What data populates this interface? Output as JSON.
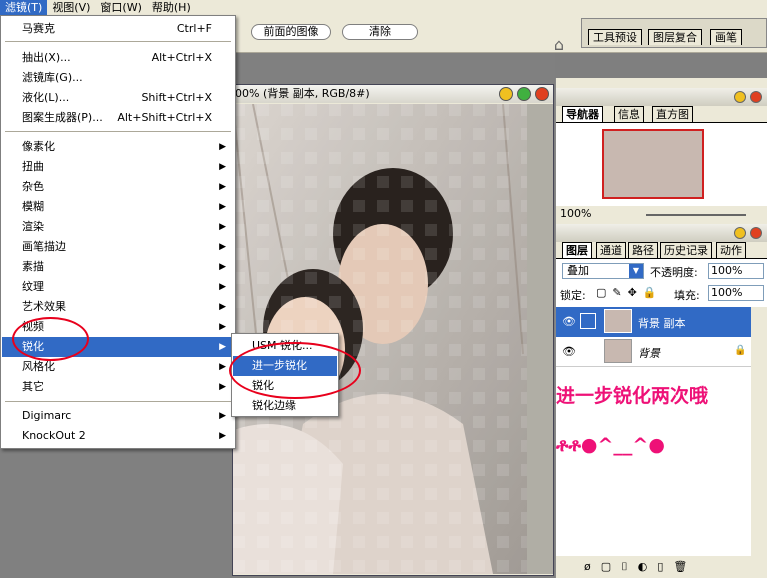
{
  "menubar": {
    "items": [
      {
        "label": "滤镜(T)",
        "active": true
      },
      {
        "label": "视图(V)"
      },
      {
        "label": "窗口(W)"
      },
      {
        "label": "帮助(H)"
      }
    ]
  },
  "options_bar": {
    "previous_state_button": "前面的图像",
    "clear_button": "清除"
  },
  "palette_well": {
    "tabs": [
      "工具预设",
      "图层复合",
      "画笔"
    ]
  },
  "document": {
    "title_suffix": "00% (背景 副本, RGB/8#)"
  },
  "navigator_panel": {
    "tabs": [
      "导航器",
      "信息",
      "直方图"
    ],
    "zoom": "100%"
  },
  "layers_panel": {
    "tabs": [
      "图层",
      "通道",
      "路径",
      "历史记录",
      "动作"
    ],
    "blend_mode": "叠加",
    "opacity_label": "不透明度:",
    "opacity_value": "100%",
    "lock_label": "锁定:",
    "fill_label": "填充:",
    "fill_value": "100%",
    "layers": [
      {
        "name": "背景 副本",
        "selected": true
      },
      {
        "name": "背景",
        "locked": true
      }
    ]
  },
  "filter_menu": {
    "items": [
      {
        "label": "马赛克",
        "shortcut": "Ctrl+F"
      },
      {
        "label": "抽出(X)...",
        "shortcut": "Alt+Ctrl+X"
      },
      {
        "label": "滤镜库(G)..."
      },
      {
        "label": "液化(L)...",
        "shortcut": "Shift+Ctrl+X"
      },
      {
        "label": "图案生成器(P)...",
        "shortcut": "Alt+Shift+Ctrl+X"
      },
      {
        "label": "像素化",
        "submenu": true
      },
      {
        "label": "扭曲",
        "submenu": true
      },
      {
        "label": "杂色",
        "submenu": true
      },
      {
        "label": "模糊",
        "submenu": true
      },
      {
        "label": "渲染",
        "submenu": true
      },
      {
        "label": "画笔描边",
        "submenu": true
      },
      {
        "label": "素描",
        "submenu": true
      },
      {
        "label": "纹理",
        "submenu": true
      },
      {
        "label": "艺术效果",
        "submenu": true
      },
      {
        "label": "视频",
        "submenu": true
      },
      {
        "label": "锐化",
        "submenu": true,
        "highlighted": true
      },
      {
        "label": "风格化",
        "submenu": true
      },
      {
        "label": "其它",
        "submenu": true
      },
      {
        "label": "Digimarc",
        "submenu": true
      },
      {
        "label": "KnockOut 2",
        "submenu": true
      }
    ]
  },
  "sharpen_submenu": {
    "items": [
      {
        "label": "USM 锐化..."
      },
      {
        "label": "进一步锐化",
        "highlighted": true
      },
      {
        "label": "锐化"
      },
      {
        "label": "锐化边缘"
      }
    ]
  },
  "annotation": {
    "text": "进一步锐化两次哦",
    "emoticon": "^__^",
    "color": "#ee1177"
  },
  "colors": {
    "highlight": "#316ac5",
    "chrome": "#ece9d8",
    "annotation_red": "#e8001c"
  }
}
